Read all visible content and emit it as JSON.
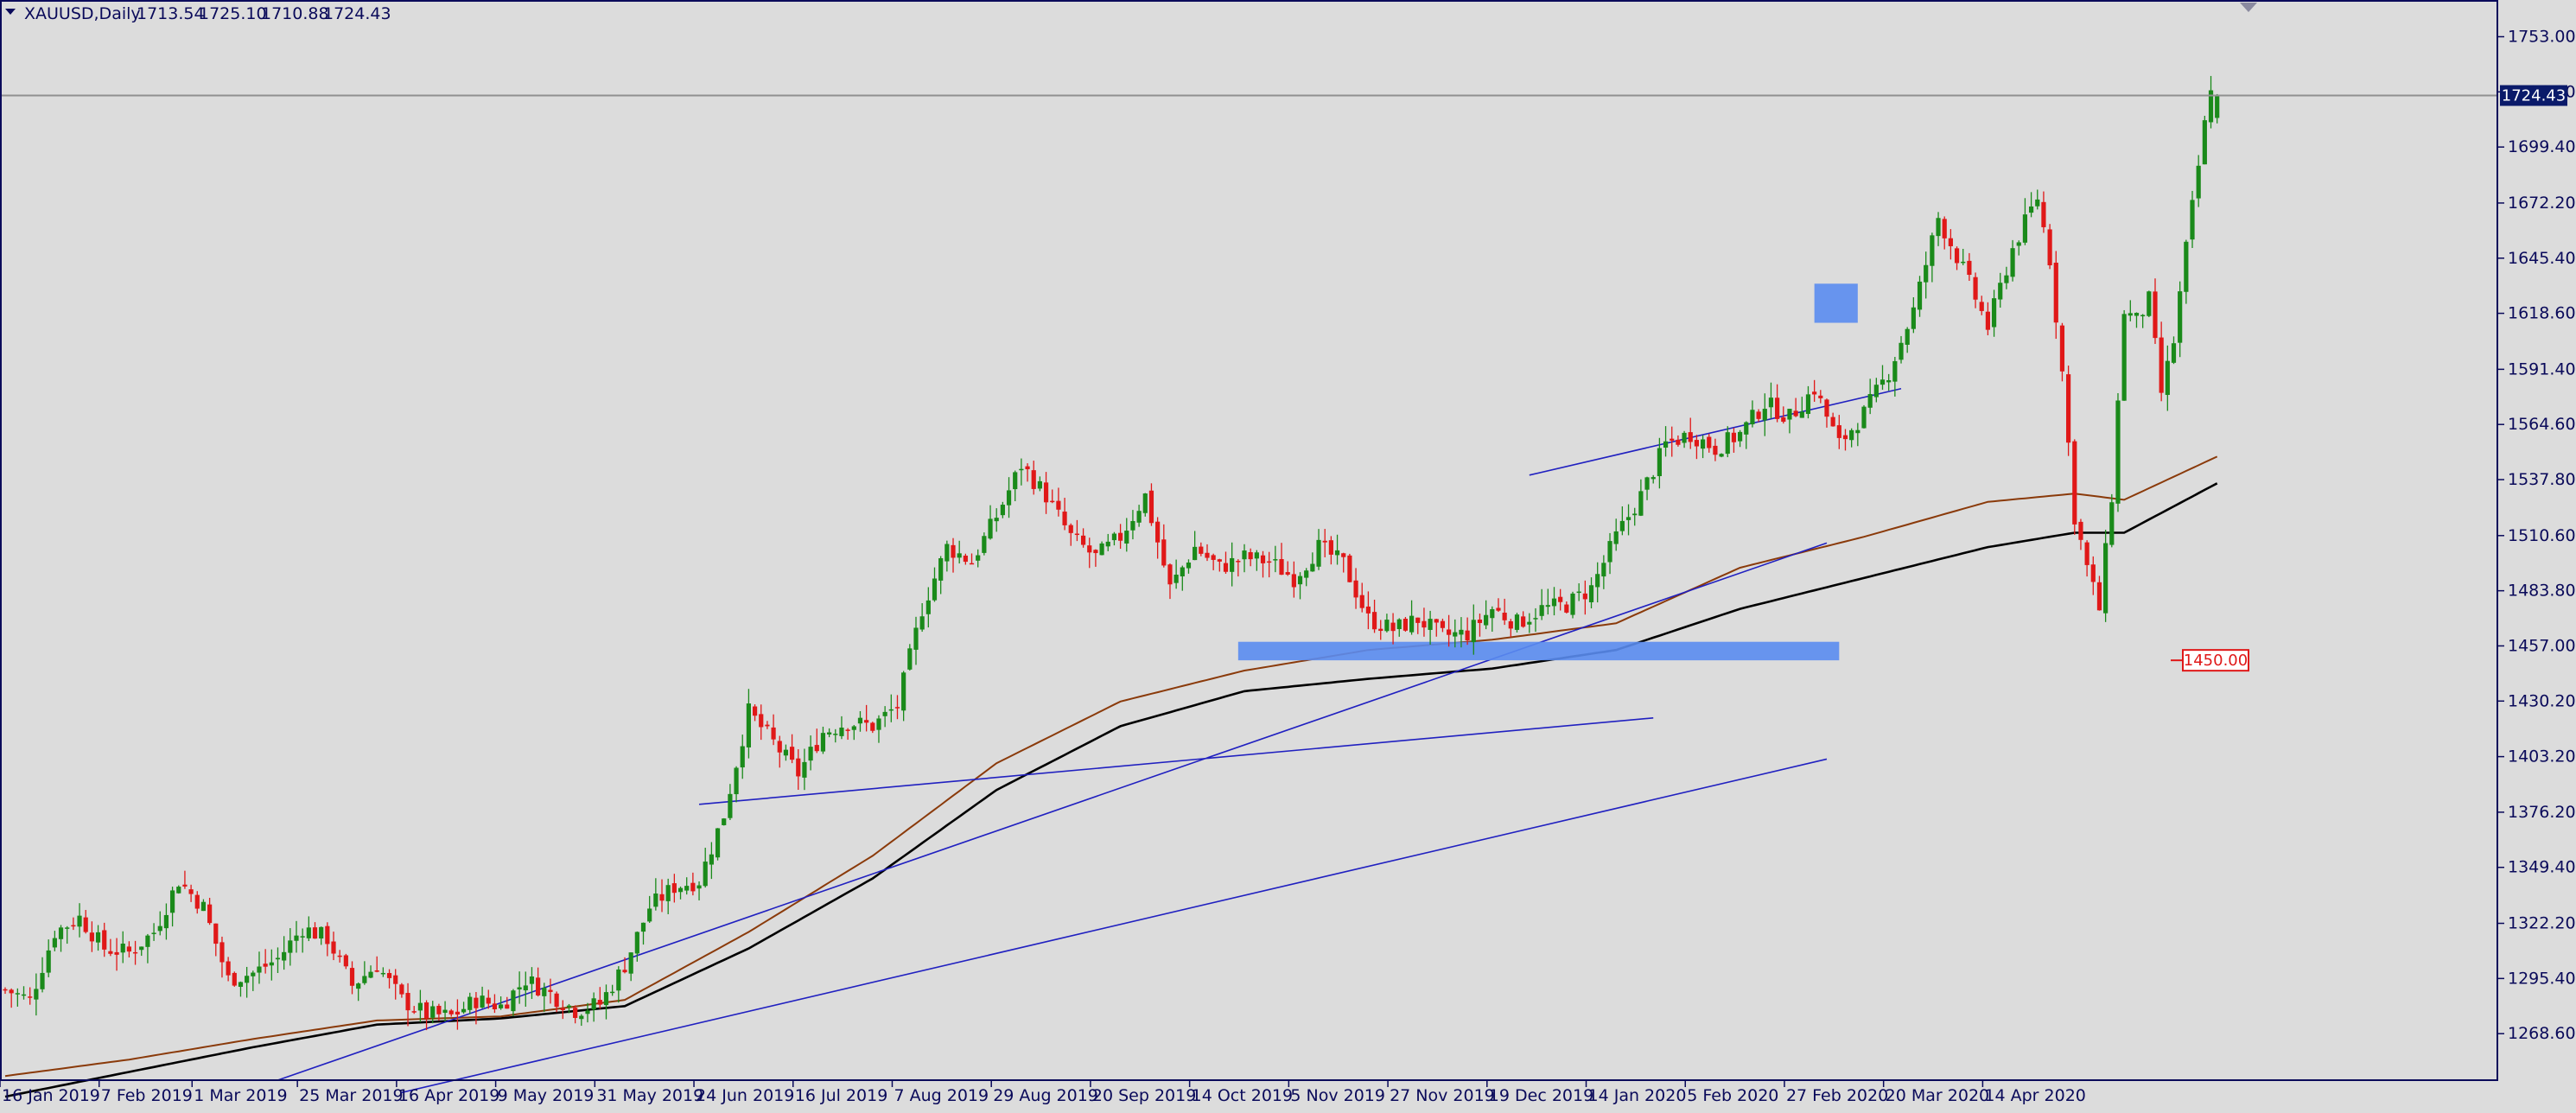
{
  "header": {
    "symbol": "XAUUSD,Daily",
    "open": "1713.54",
    "high": "1725.10",
    "low": "1710.88",
    "close": "1724.43"
  },
  "colors": {
    "background": "#dcdcdc",
    "bull_candle": "#1a8a1a",
    "bear_candle": "#e01818",
    "axis_text": "#0a0a5a",
    "trendline": "#2020c0",
    "zone": "#5a8cf0",
    "ma_fast": "#8a3a0a",
    "ma_slow": "#000000",
    "price_tag": "#0a1a6a",
    "level_tag": "#e01818"
  },
  "chart_data": {
    "type": "candlestick",
    "symbol": "XAUUSD",
    "timeframe": "Daily",
    "ylim": [
      1246,
      1770
    ],
    "y_ticks": [
      "1753.00",
      "1726.20",
      "1699.40",
      "1672.20",
      "1645.40",
      "1618.60",
      "1591.40",
      "1564.60",
      "1537.80",
      "1510.60",
      "1483.80",
      "1457.00",
      "1430.20",
      "1403.20",
      "1376.20",
      "1349.40",
      "1322.20",
      "1295.40",
      "1268.60"
    ],
    "x_ticks": [
      "16 Jan 2019",
      "7 Feb 2019",
      "1 Mar 2019",
      "25 Mar 2019",
      "16 Apr 2019",
      "9 May 2019",
      "31 May 2019",
      "24 Jun 2019",
      "16 Jul 2019",
      "7 Aug 2019",
      "29 Aug 2019",
      "20 Sep 2019",
      "14 Oct 2019",
      "5 Nov 2019",
      "27 Nov 2019",
      "19 Dec 2019",
      "14 Jan 2020",
      "5 Feb 2020",
      "27 Feb 2020",
      "20 Mar 2020",
      "14 Apr 2020"
    ],
    "last_price": "1724.43",
    "level_label": "1450.00",
    "close_path": [
      {
        "i": 0,
        "c": 1290
      },
      {
        "i": 4,
        "c": 1285
      },
      {
        "i": 8,
        "c": 1318
      },
      {
        "i": 12,
        "c": 1325
      },
      {
        "i": 16,
        "c": 1310
      },
      {
        "i": 20,
        "c": 1308
      },
      {
        "i": 24,
        "c": 1318
      },
      {
        "i": 28,
        "c": 1343
      },
      {
        "i": 32,
        "c": 1330
      },
      {
        "i": 36,
        "c": 1295
      },
      {
        "i": 40,
        "c": 1298
      },
      {
        "i": 44,
        "c": 1305
      },
      {
        "i": 48,
        "c": 1320
      },
      {
        "i": 52,
        "c": 1315
      },
      {
        "i": 56,
        "c": 1292
      },
      {
        "i": 60,
        "c": 1302
      },
      {
        "i": 64,
        "c": 1285
      },
      {
        "i": 68,
        "c": 1278
      },
      {
        "i": 72,
        "c": 1277
      },
      {
        "i": 76,
        "c": 1285
      },
      {
        "i": 80,
        "c": 1282
      },
      {
        "i": 84,
        "c": 1295
      },
      {
        "i": 88,
        "c": 1288
      },
      {
        "i": 92,
        "c": 1280
      },
      {
        "i": 96,
        "c": 1283
      },
      {
        "i": 100,
        "c": 1302
      },
      {
        "i": 104,
        "c": 1330
      },
      {
        "i": 108,
        "c": 1340
      },
      {
        "i": 112,
        "c": 1343
      },
      {
        "i": 116,
        "c": 1375
      },
      {
        "i": 120,
        "c": 1425
      },
      {
        "i": 124,
        "c": 1410
      },
      {
        "i": 128,
        "c": 1395
      },
      {
        "i": 132,
        "c": 1415
      },
      {
        "i": 136,
        "c": 1420
      },
      {
        "i": 140,
        "c": 1418
      },
      {
        "i": 144,
        "c": 1428
      },
      {
        "i": 148,
        "c": 1475
      },
      {
        "i": 152,
        "c": 1505
      },
      {
        "i": 156,
        "c": 1498
      },
      {
        "i": 160,
        "c": 1520
      },
      {
        "i": 164,
        "c": 1545
      },
      {
        "i": 168,
        "c": 1530
      },
      {
        "i": 172,
        "c": 1510
      },
      {
        "i": 176,
        "c": 1500
      },
      {
        "i": 180,
        "c": 1510
      },
      {
        "i": 184,
        "c": 1530
      },
      {
        "i": 188,
        "c": 1485
      },
      {
        "i": 192,
        "c": 1505
      },
      {
        "i": 196,
        "c": 1495
      },
      {
        "i": 200,
        "c": 1500
      },
      {
        "i": 204,
        "c": 1498
      },
      {
        "i": 208,
        "c": 1490
      },
      {
        "i": 212,
        "c": 1505
      },
      {
        "i": 216,
        "c": 1497
      },
      {
        "i": 220,
        "c": 1470
      },
      {
        "i": 224,
        "c": 1465
      },
      {
        "i": 228,
        "c": 1470
      },
      {
        "i": 232,
        "c": 1462
      },
      {
        "i": 236,
        "c": 1463
      },
      {
        "i": 240,
        "c": 1475
      },
      {
        "i": 244,
        "c": 1468
      },
      {
        "i": 248,
        "c": 1475
      },
      {
        "i": 252,
        "c": 1477
      },
      {
        "i": 256,
        "c": 1485
      },
      {
        "i": 260,
        "c": 1510
      },
      {
        "i": 264,
        "c": 1530
      },
      {
        "i": 268,
        "c": 1555
      },
      {
        "i": 272,
        "c": 1560
      },
      {
        "i": 276,
        "c": 1553
      },
      {
        "i": 280,
        "c": 1560
      },
      {
        "i": 284,
        "c": 1575
      },
      {
        "i": 288,
        "c": 1568
      },
      {
        "i": 292,
        "c": 1582
      },
      {
        "i": 296,
        "c": 1555
      },
      {
        "i": 300,
        "c": 1570
      },
      {
        "i": 304,
        "c": 1590
      },
      {
        "i": 308,
        "c": 1620
      },
      {
        "i": 312,
        "c": 1665
      },
      {
        "i": 316,
        "c": 1640
      },
      {
        "i": 320,
        "c": 1612
      },
      {
        "i": 324,
        "c": 1650
      },
      {
        "i": 328,
        "c": 1675
      },
      {
        "i": 330,
        "c": 1645
      },
      {
        "i": 332,
        "c": 1590
      },
      {
        "i": 334,
        "c": 1520
      },
      {
        "i": 336,
        "c": 1495
      },
      {
        "i": 338,
        "c": 1475
      },
      {
        "i": 340,
        "c": 1530
      },
      {
        "i": 342,
        "c": 1620
      },
      {
        "i": 344,
        "c": 1615
      },
      {
        "i": 346,
        "c": 1625
      },
      {
        "i": 348,
        "c": 1580
      },
      {
        "i": 350,
        "c": 1605
      },
      {
        "i": 352,
        "c": 1650
      },
      {
        "i": 354,
        "c": 1690
      },
      {
        "i": 356,
        "c": 1730
      },
      {
        "i": 357,
        "c": 1724.43
      }
    ],
    "moving_averages": [
      {
        "color_key": "ma_fast",
        "points": [
          {
            "i": 0,
            "v": 1248
          },
          {
            "i": 20,
            "v": 1256
          },
          {
            "i": 40,
            "v": 1266
          },
          {
            "i": 60,
            "v": 1275
          },
          {
            "i": 80,
            "v": 1277
          },
          {
            "i": 100,
            "v": 1285
          },
          {
            "i": 120,
            "v": 1318
          },
          {
            "i": 140,
            "v": 1355
          },
          {
            "i": 160,
            "v": 1400
          },
          {
            "i": 180,
            "v": 1430
          },
          {
            "i": 200,
            "v": 1445
          },
          {
            "i": 220,
            "v": 1455
          },
          {
            "i": 240,
            "v": 1460
          },
          {
            "i": 260,
            "v": 1468
          },
          {
            "i": 280,
            "v": 1495
          },
          {
            "i": 300,
            "v": 1510
          },
          {
            "i": 320,
            "v": 1527
          },
          {
            "i": 334,
            "v": 1531
          },
          {
            "i": 342,
            "v": 1528
          },
          {
            "i": 357,
            "v": 1549
          }
        ]
      },
      {
        "color_key": "ma_slow",
        "points": [
          {
            "i": 0,
            "v": 1238
          },
          {
            "i": 20,
            "v": 1250
          },
          {
            "i": 40,
            "v": 1262
          },
          {
            "i": 60,
            "v": 1273
          },
          {
            "i": 80,
            "v": 1276
          },
          {
            "i": 100,
            "v": 1282
          },
          {
            "i": 120,
            "v": 1310
          },
          {
            "i": 140,
            "v": 1344
          },
          {
            "i": 160,
            "v": 1387
          },
          {
            "i": 180,
            "v": 1418
          },
          {
            "i": 200,
            "v": 1435
          },
          {
            "i": 220,
            "v": 1441
          },
          {
            "i": 240,
            "v": 1446
          },
          {
            "i": 260,
            "v": 1455
          },
          {
            "i": 280,
            "v": 1475
          },
          {
            "i": 300,
            "v": 1490
          },
          {
            "i": 320,
            "v": 1505
          },
          {
            "i": 334,
            "v": 1512
          },
          {
            "i": 342,
            "v": 1512
          },
          {
            "i": 357,
            "v": 1536
          }
        ]
      }
    ],
    "trendlines": [
      {
        "x1": 44,
        "y1": 1246,
        "x2": 294,
        "y2": 1507
      },
      {
        "x1": 112,
        "y1": 1380,
        "x2": 266,
        "y2": 1422
      },
      {
        "x1": 246,
        "y1": 1540,
        "x2": 306,
        "y2": 1582
      },
      {
        "x1": 64,
        "y1": 1240,
        "x2": 294,
        "y2": 1402
      }
    ],
    "zones": [
      {
        "x1": 199,
        "x2": 296,
        "y1": 1450,
        "y2": 1459
      },
      {
        "x1": 292,
        "x2": 299,
        "y1": 1614,
        "y2": 1633
      }
    ]
  }
}
